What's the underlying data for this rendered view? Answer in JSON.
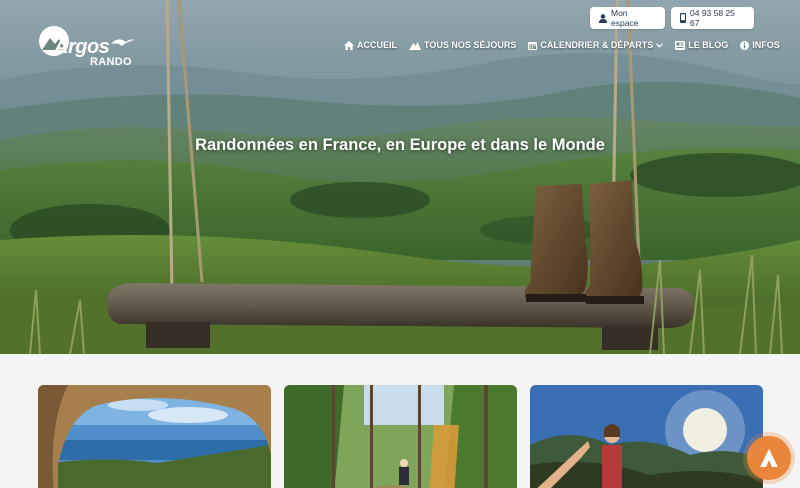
{
  "brand": {
    "name": "Argos",
    "sub": "RANDO"
  },
  "header": {
    "account_label": "Mon espace",
    "phone": "04 93 58 25 67"
  },
  "nav": [
    {
      "label": "ACCUEIL",
      "icon": "home-icon"
    },
    {
      "label": "TOUS NOS SÉJOURS",
      "icon": "mountain-icon"
    },
    {
      "label": "CALENDRIER & DÉPARTS",
      "icon": "calendar-icon",
      "dropdown": true
    },
    {
      "label": "LE BLOG",
      "icon": "newspaper-icon"
    },
    {
      "label": "INFOS",
      "icon": "info-icon"
    }
  ],
  "hero": {
    "headline": "Randonnées en France, en Europe et dans le Monde"
  },
  "cards": [
    {
      "image": "coastal-arch-photo"
    },
    {
      "image": "forest-hikers-photo"
    },
    {
      "image": "mountain-highfive-photo"
    }
  ],
  "colors": {
    "accent": "#e9863b",
    "navy": "#233b58"
  }
}
